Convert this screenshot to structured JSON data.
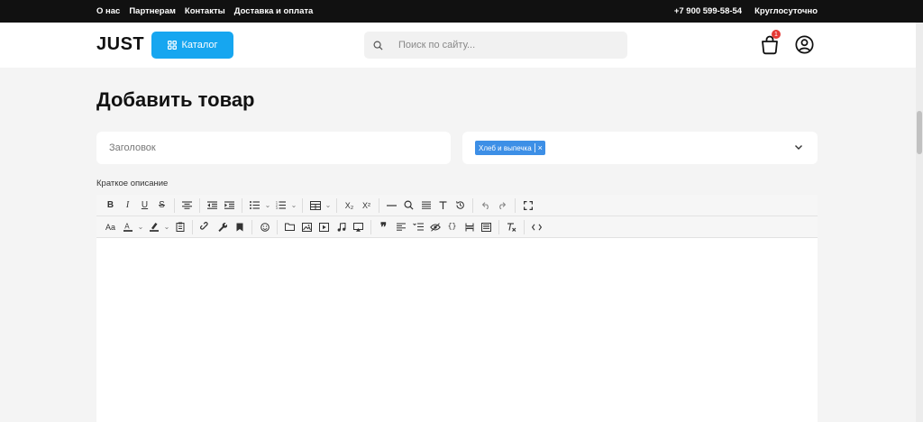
{
  "topbar": {
    "links": [
      "О нас",
      "Партнерам",
      "Контакты",
      "Доставка и оплата"
    ],
    "phone": "+7 900 599-58-54",
    "hours": "Круглосуточно"
  },
  "header": {
    "logo": "JUST",
    "catalog_label": "Каталог",
    "search_placeholder": "Поиск по сайту...",
    "cart_count": "1"
  },
  "page": {
    "title": "Добавить товар",
    "title_placeholder": "Заголовок",
    "category_tag": "Хлеб и выпечка",
    "tag_remove": "×",
    "short_desc_label": "Краткое описание"
  },
  "toolbar": {
    "bold": "B",
    "italic": "I",
    "underline": "U",
    "strike": "S",
    "subscript": "X₂",
    "superscript": "X²",
    "font_size": "Aa"
  },
  "colors": {
    "accent": "#16a6f0",
    "tag": "#3d8fe6",
    "badge": "#e53935",
    "topbar": "#111111"
  }
}
